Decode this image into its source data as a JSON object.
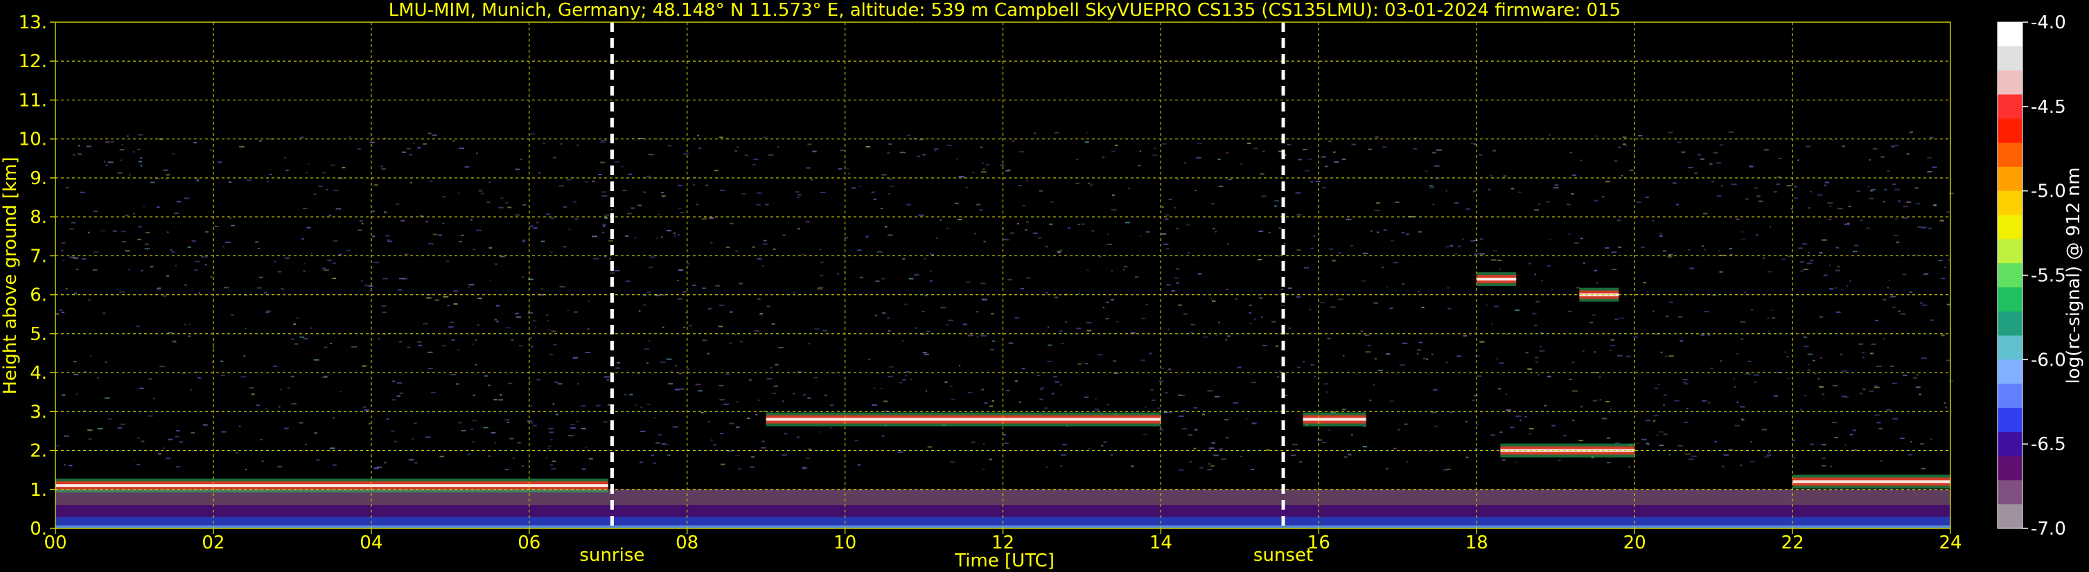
{
  "chart_data": {
    "type": "heatmap",
    "title": "LMU-MIM, Munich, Germany; 48.148° N 11.573° E, altitude: 539 m    Campbell SkyVUEPRO CS135 (CS135LMU): 03-01-2024    firmware: 015",
    "xlabel": "Time [UTC]",
    "ylabel": "Height above ground [km]",
    "xlim": [
      0,
      24
    ],
    "ylim": [
      0,
      13
    ],
    "x_ticks": [
      "00",
      "02",
      "04",
      "06",
      "08",
      "10",
      "12",
      "14",
      "16",
      "18",
      "20",
      "22",
      "24"
    ],
    "y_ticks": [
      "0.",
      "1.",
      "2.",
      "3.",
      "4.",
      "5.",
      "6.",
      "7.",
      "8.",
      "9.",
      "10.",
      "11.",
      "12.",
      "13."
    ],
    "grid": true,
    "markers": [
      {
        "label": "sunrise",
        "x": 7.05
      },
      {
        "label": "sunset",
        "x": 15.55
      }
    ],
    "colorbar": {
      "label": "log(rc-signal) @ 912 nm",
      "range": [
        -7.0,
        -4.0
      ],
      "ticks": [
        "-4.0",
        "-4.5",
        "-5.0",
        "-5.5",
        "-6.0",
        "-6.5",
        "-7.0"
      ],
      "colors": [
        "#ffffff",
        "#e0e0e0",
        "#f0c0c0",
        "#ff3030",
        "#ff2000",
        "#ff6000",
        "#ffa000",
        "#ffd000",
        "#f0f000",
        "#c0f040",
        "#60e060",
        "#20c060",
        "#20a080",
        "#60c0d0",
        "#80b0ff",
        "#6080ff",
        "#3040f0",
        "#4010a0",
        "#601070",
        "#805080",
        "#a090a0"
      ]
    },
    "cloud_layers": [
      {
        "x_start": 0.0,
        "x_end": 7.0,
        "height_km": 1.1
      },
      {
        "x_start": 9.0,
        "x_end": 14.0,
        "height_km": 2.8
      },
      {
        "x_start": 15.8,
        "x_end": 16.6,
        "height_km": 2.8
      },
      {
        "x_start": 18.0,
        "x_end": 18.5,
        "height_km": 6.4
      },
      {
        "x_start": 18.3,
        "x_end": 20.0,
        "height_km": 2.0
      },
      {
        "x_start": 19.3,
        "x_end": 19.8,
        "height_km": 6.0
      },
      {
        "x_start": 22.0,
        "x_end": 24.0,
        "height_km": 1.2
      }
    ],
    "noise_top_km": 10.2,
    "boundary_layer_km": 1.0
  }
}
